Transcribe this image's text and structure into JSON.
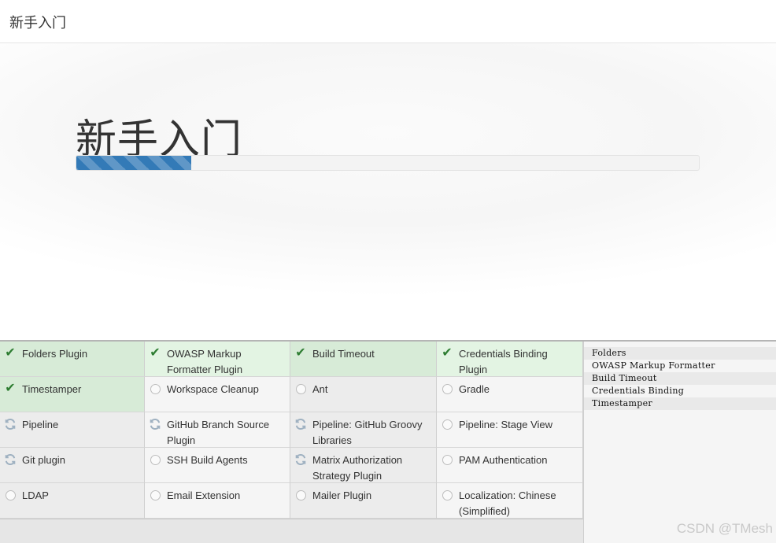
{
  "header": {
    "title": "新手入门"
  },
  "hero": {
    "title": "新手入门",
    "progress_percent": 18.5
  },
  "colors": {
    "success_bg": "#d7ebd7",
    "check": "#2e7d32",
    "progress": "#337ab7"
  },
  "plugins": [
    {
      "name": "Folders Plugin",
      "status": "success",
      "icon": "check-icon"
    },
    {
      "name": "OWASP Markup Formatter Plugin",
      "status": "success",
      "icon": "check-icon"
    },
    {
      "name": "Build Timeout",
      "status": "success",
      "icon": "check-icon"
    },
    {
      "name": "Credentials Binding Plugin",
      "status": "success",
      "icon": "check-icon"
    },
    {
      "name": "Timestamper",
      "status": "success",
      "icon": "check-icon"
    },
    {
      "name": "Workspace Cleanup",
      "status": "pending",
      "icon": "circle-icon"
    },
    {
      "name": "Ant",
      "status": "pending",
      "icon": "circle-icon"
    },
    {
      "name": "Gradle",
      "status": "pending",
      "icon": "circle-icon"
    },
    {
      "name": "Pipeline",
      "status": "installing",
      "icon": "refresh-icon"
    },
    {
      "name": "GitHub Branch Source Plugin",
      "status": "installing",
      "icon": "refresh-icon"
    },
    {
      "name": "Pipeline: GitHub Groovy Libraries",
      "status": "installing",
      "icon": "refresh-icon"
    },
    {
      "name": "Pipeline: Stage View",
      "status": "pending",
      "icon": "circle-icon"
    },
    {
      "name": "Git plugin",
      "status": "installing",
      "icon": "refresh-icon"
    },
    {
      "name": "SSH Build Agents",
      "status": "pending",
      "icon": "circle-icon"
    },
    {
      "name": "Matrix Authorization Strategy Plugin",
      "status": "installing",
      "icon": "refresh-icon"
    },
    {
      "name": "PAM Authentication",
      "status": "pending",
      "icon": "circle-icon"
    },
    {
      "name": "LDAP",
      "status": "pending",
      "icon": "circle-icon"
    },
    {
      "name": "Email Extension",
      "status": "pending",
      "icon": "circle-icon"
    },
    {
      "name": "Mailer Plugin",
      "status": "pending",
      "icon": "circle-icon"
    },
    {
      "name": "Localization: Chinese (Simplified)",
      "status": "pending",
      "icon": "circle-icon"
    }
  ],
  "install_log": [
    "Folders",
    "OWASP Markup Formatter",
    "Build Timeout",
    "Credentials Binding",
    "Timestamper"
  ],
  "watermark": "CSDN @TMesh"
}
